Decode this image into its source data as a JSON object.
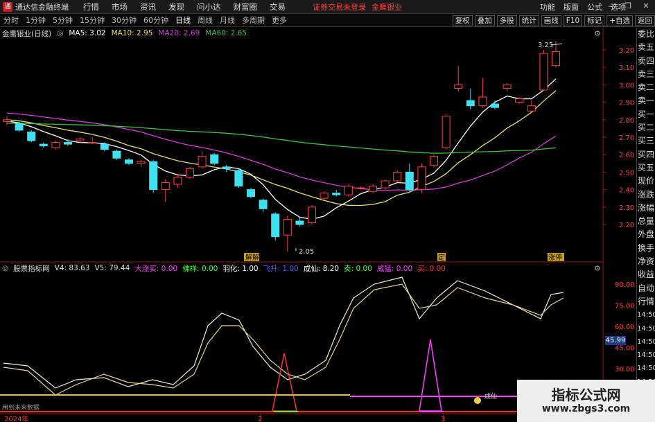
{
  "titlebar": {
    "app_title": "通达信金融终端",
    "menu": [
      "行情",
      "市场",
      "资讯",
      "发现",
      "问小达",
      "财富圈",
      "交易"
    ],
    "broker_status": "证券交易未登录",
    "stock_name": "金鹰银业",
    "right_menu": [
      "功能",
      "版面",
      "公式",
      "选项"
    ],
    "window_buttons": [
      "—",
      "❐",
      "✕"
    ]
  },
  "toolbar": {
    "periods": [
      "分时",
      "1分钟",
      "5分钟",
      "15分钟",
      "30分钟",
      "60分钟",
      "日线",
      "周线",
      "月线",
      "多周期",
      "更多"
    ],
    "active_period": "日线",
    "right_buttons": [
      "复权",
      "叠加",
      "多股",
      "统计",
      "画线",
      "F10",
      "标记",
      "+自选",
      "返回"
    ]
  },
  "main_info": {
    "stock": "金鹰银业(日线)",
    "ma5": "MA5: 3.02",
    "ma10": "MA10: 2.95",
    "ma20": "MA20: 2.69",
    "ma60": "MA60: 2.65",
    "colors": {
      "ma5": "#ffffff",
      "ma10": "#e8e070",
      "ma20": "#d040d0",
      "ma60": "#40c040"
    }
  },
  "sub_info": {
    "name": "股票指标网",
    "v4": "V4: 83.63",
    "v5": "V5: 79.44",
    "items": [
      {
        "label": "大涨买: 0.00",
        "color": "#ff40ff"
      },
      {
        "label": "佛祥: 0.00",
        "color": "#40ff40"
      },
      {
        "label": "羽化: 1.00",
        "color": "#ffffff"
      },
      {
        "label": "飞升: 1.00",
        "color": "#4060ff"
      },
      {
        "label": "成仙: 8.20",
        "color": "#ffffff"
      },
      {
        "label": "卖: 0.00",
        "color": "#40ff40"
      },
      {
        "label": "威猛: 0.00",
        "color": "#ff40ff"
      },
      {
        "label": "买: 0.00",
        "color": "#ff3030"
      }
    ]
  },
  "price_axis": [
    "3.20",
    "3.10",
    "3.00",
    "2.90",
    "2.80",
    "2.70",
    "2.60",
    "2.50",
    "2.40",
    "2.30",
    "2.20"
  ],
  "indicator_axis": [
    "90.00",
    "75.00",
    "60.00",
    "45.00",
    "30.00"
  ],
  "indicator_badge": "45.99",
  "annotations": {
    "high": "3.25",
    "low": "2.05",
    "tag_jiekai": "解解",
    "tag_ding": "定",
    "tag_zhangting": "涨停",
    "tag_chengxian": "成仙",
    "no_future": "用到未来数据"
  },
  "date_axis": [
    "2024年",
    "2",
    "3"
  ],
  "right_panel": [
    "委比",
    "卖五",
    "卖四",
    "卖三",
    "卖二",
    "卖一",
    "买一",
    "买二",
    "买三",
    "买四",
    "买五",
    "现价",
    "涨跌",
    "涨幅",
    "总量",
    "外盘",
    "换手",
    "净资",
    "收益",
    "自动",
    "行情",
    "14:50",
    "14:50",
    "14:50",
    "14:50",
    "14:50",
    "14:50",
    "14:50"
  ],
  "watermark": {
    "title": "指标公式网",
    "url": "www.zbgs3.com"
  },
  "chart_data": {
    "type": "candlestick",
    "candles": [
      [
        2.79,
        2.8,
        2.82,
        2.77
      ],
      [
        2.78,
        2.74,
        2.79,
        2.73
      ],
      [
        2.73,
        2.68,
        2.74,
        2.67
      ],
      [
        2.66,
        2.65,
        2.67,
        2.64
      ],
      [
        2.64,
        2.67,
        2.68,
        2.63
      ],
      [
        2.67,
        2.66,
        2.69,
        2.65
      ],
      [
        2.68,
        2.69,
        2.7,
        2.67
      ],
      [
        2.67,
        2.67,
        2.7,
        2.66
      ],
      [
        2.66,
        2.63,
        2.67,
        2.62
      ],
      [
        2.62,
        2.58,
        2.63,
        2.57
      ],
      [
        2.57,
        2.55,
        2.58,
        2.54
      ],
      [
        2.55,
        2.56,
        2.57,
        2.53
      ],
      [
        2.56,
        2.4,
        2.57,
        2.38
      ],
      [
        2.4,
        2.44,
        2.46,
        2.33
      ],
      [
        2.43,
        2.47,
        2.49,
        2.41
      ],
      [
        2.47,
        2.52,
        2.53,
        2.46
      ],
      [
        2.53,
        2.59,
        2.62,
        2.52
      ],
      [
        2.6,
        2.55,
        2.61,
        2.54
      ],
      [
        2.53,
        2.52,
        2.54,
        2.5
      ],
      [
        2.51,
        2.42,
        2.52,
        2.41
      ],
      [
        2.4,
        2.36,
        2.41,
        2.35
      ],
      [
        2.34,
        2.29,
        2.35,
        2.27
      ],
      [
        2.26,
        2.13,
        2.27,
        2.11
      ],
      [
        2.14,
        2.23,
        2.25,
        2.05
      ],
      [
        2.22,
        2.2,
        2.24,
        2.19
      ],
      [
        2.21,
        2.3,
        2.31,
        2.2
      ],
      [
        2.35,
        2.38,
        2.39,
        2.34
      ],
      [
        2.38,
        2.37,
        2.4,
        2.36
      ],
      [
        2.37,
        2.42,
        2.43,
        2.36
      ],
      [
        2.41,
        2.41,
        2.42,
        2.4
      ],
      [
        2.39,
        2.42,
        2.43,
        2.38
      ],
      [
        2.41,
        2.45,
        2.46,
        2.4
      ],
      [
        2.45,
        2.5,
        2.51,
        2.44
      ],
      [
        2.5,
        2.4,
        2.55,
        2.39
      ],
      [
        2.4,
        2.53,
        2.55,
        2.38
      ],
      [
        2.54,
        2.59,
        2.6,
        2.53
      ],
      [
        2.64,
        2.82,
        2.83,
        2.63
      ],
      [
        2.98,
        3.0,
        3.11,
        2.96
      ],
      [
        2.91,
        2.88,
        2.98,
        2.86
      ],
      [
        2.88,
        2.93,
        3.04,
        2.87
      ],
      [
        2.89,
        2.87,
        2.91,
        2.86
      ],
      [
        2.98,
        3.0,
        3.01,
        2.96
      ],
      [
        2.9,
        2.92,
        2.93,
        2.89
      ],
      [
        2.85,
        2.88,
        2.91,
        2.84
      ],
      [
        2.97,
        3.18,
        3.2,
        2.97
      ],
      [
        3.11,
        3.19,
        3.25,
        3.1
      ]
    ],
    "ylim": [
      2.15,
      3.27
    ]
  }
}
